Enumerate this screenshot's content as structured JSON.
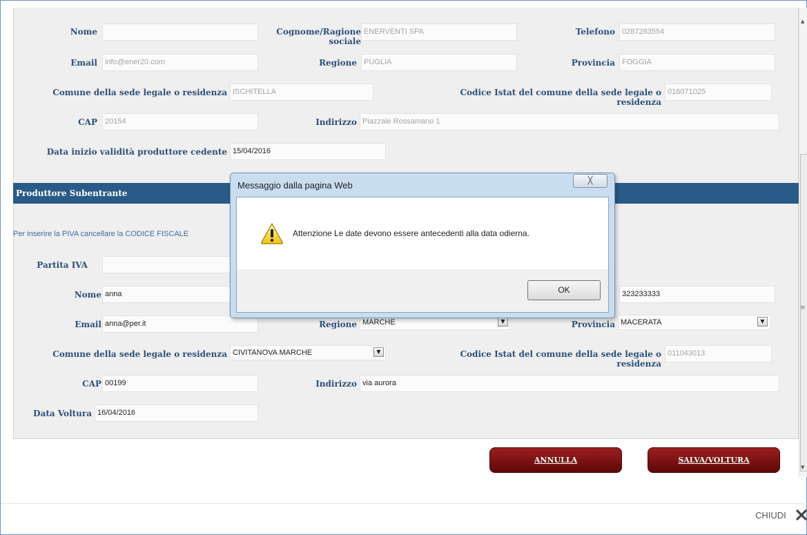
{
  "cedente": {
    "nome": {
      "label": "Nome",
      "value": ""
    },
    "cognome": {
      "label": "Cognome/Ragione sociale",
      "value": "ENERVENTI SPA"
    },
    "telefono": {
      "label": "Telefono",
      "value": "0287283554"
    },
    "email": {
      "label": "Email",
      "value": "info@ener20.com"
    },
    "regione": {
      "label": "Regione",
      "value": "PUGLIA"
    },
    "provincia": {
      "label": "Provincia",
      "value": "FOGGIA"
    },
    "comune": {
      "label": "Comune della sede legale o residenza",
      "value": "ISCHITELLA"
    },
    "istat": {
      "label": "Codice Istat del comune della sede legale o residenza",
      "value": "016071025"
    },
    "cap": {
      "label": "CAP",
      "value": "20154"
    },
    "indirizzo": {
      "label": "Indirizzo",
      "value": "Piazzale Rossamano 1"
    },
    "data_inizio": {
      "label": "Data inizio validità produttore cedente",
      "value": "15/04/2016"
    }
  },
  "subentrante": {
    "section_title": "Produttore Subentrante",
    "piva_hint": "Per inserire la PIVA cancellare la CODICE FISCALE",
    "piva": {
      "label": "Partita IVA",
      "value": ""
    },
    "nome": {
      "label": "Nome",
      "value": "anna"
    },
    "telefono": {
      "value": "323233333"
    },
    "email": {
      "label": "Email",
      "value": "anna@per.it"
    },
    "regione": {
      "label": "Regione",
      "value": "MARCHE"
    },
    "provincia": {
      "label": "Provincia",
      "value": "MACERATA"
    },
    "comune": {
      "label": "Comune della sede legale o residenza",
      "value": "CIVITANOVA MARCHE"
    },
    "istat": {
      "label": "Codice Istat del comune della sede legale o residenza",
      "value": "011043013"
    },
    "cap": {
      "label": "CAP",
      "value": "00199"
    },
    "indirizzo": {
      "label": "Indirizzo",
      "value": "via aurora"
    },
    "data_voltura": {
      "label": "Data Voltura",
      "value": "16/04/2016"
    }
  },
  "actions": {
    "annulla": "ANNULLA",
    "salva": "SALVA/VOLTURA"
  },
  "footer": {
    "close_label": "CHIUDI"
  },
  "dialog": {
    "title": "Messaggio dalla pagina Web",
    "message": "Attenzione Le date devono essere antecedenti alla data odierna.",
    "ok_label": "OK",
    "close_glyph": "╳"
  },
  "colors": {
    "label": "#2b4f7a",
    "header": "#2a5a87",
    "button": "#7a1010",
    "dialog_frame": "#c9ddf1"
  }
}
